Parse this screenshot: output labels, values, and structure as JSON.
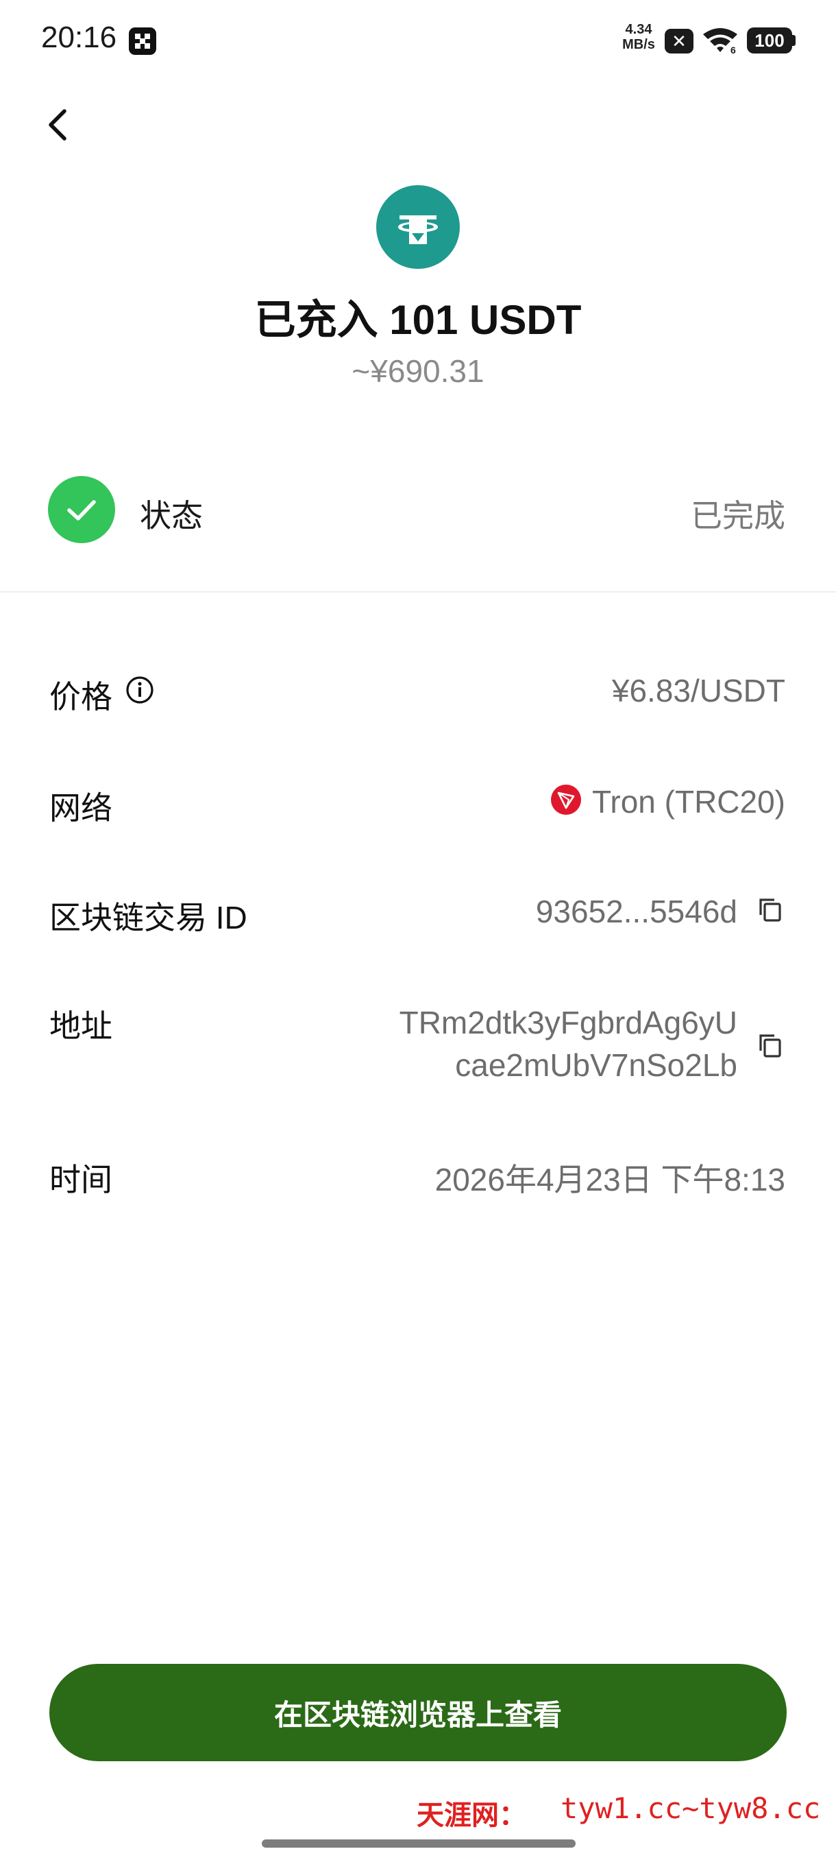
{
  "status_bar": {
    "time": "20:16",
    "net_speed_value": "4.34",
    "net_speed_unit": "MB/s",
    "sim_x": "✕",
    "battery": "100",
    "app_icon": "grid-app-icon",
    "wifi_icon": "wifi-6-icon"
  },
  "nav": {
    "back_icon": "chevron-left-icon"
  },
  "header": {
    "coin_icon": "tether-usdt-icon",
    "title": "已充入 101  USDT",
    "fiat_equivalent": "~¥690.31"
  },
  "status": {
    "label": "状态",
    "value": "已完成",
    "icon": "check-circle-icon",
    "color": "#33c45a"
  },
  "details": {
    "price": {
      "label": "价格",
      "value": "¥6.83/USDT",
      "info_icon": "info-icon"
    },
    "network": {
      "label": "网络",
      "value": "Tron (TRC20)",
      "icon": "tron-icon"
    },
    "tx_id": {
      "label": "区块链交易 ID",
      "value": "93652...5546d",
      "copy_icon": "copy-icon"
    },
    "address": {
      "label": "地址",
      "value_line1": "TRm2dtk3yFgbrdAg6yU",
      "value_line2": "cae2mUbV7nSo2Lb",
      "copy_icon": "copy-icon"
    },
    "time": {
      "label": "时间",
      "value": "2026年4月23日 下午8:13"
    }
  },
  "actions": {
    "explorer_button_label": "在区块链浏览器上查看",
    "button_color": "#2b6a16"
  },
  "watermark": {
    "site_name": "天涯网：",
    "domains": "tyw1.cc~tyw8.cc"
  }
}
